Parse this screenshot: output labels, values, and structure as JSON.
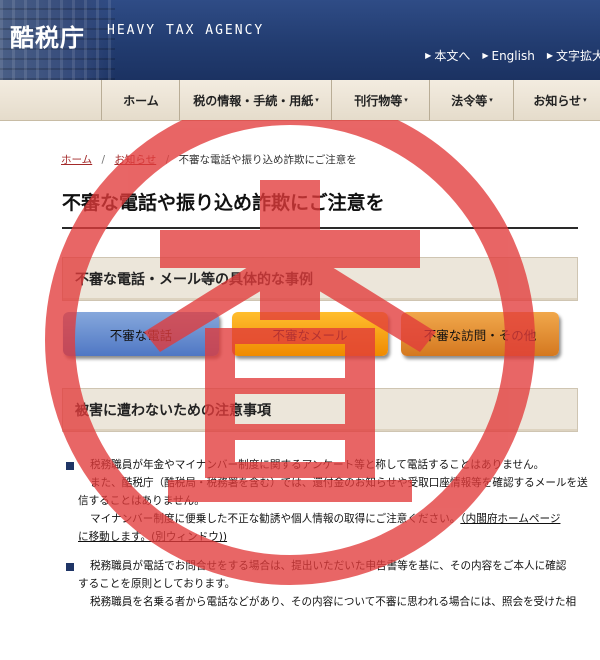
{
  "header": {
    "logo_kanji": "酷税庁",
    "logo_en": "HEAVY TAX AGENCY",
    "links": [
      {
        "label": "本文へ"
      },
      {
        "label": "English"
      },
      {
        "label": "文字拡大"
      }
    ]
  },
  "nav": {
    "items": [
      {
        "label": "ホーム",
        "has_caret": false
      },
      {
        "label": "税の情報・手続・用紙",
        "has_caret": true
      },
      {
        "label": "刊行物等",
        "has_caret": true
      },
      {
        "label": "法令等",
        "has_caret": true
      },
      {
        "label": "お知らせ",
        "has_caret": true
      }
    ],
    "caret": "▾"
  },
  "breadcrumb": {
    "items": [
      "ホーム",
      "お知らせ",
      "不審な電話や振り込め詐欺にご注意を"
    ],
    "separator": "/"
  },
  "page_title": "不審な電話や振り込め詐欺にご注意を",
  "sections": {
    "cases_heading": "不審な電話・メール等の具体的な事例",
    "precautions_heading": "被害に遭わないための注意事項"
  },
  "case_buttons": [
    {
      "label": "不審な電話",
      "color": "#4f77c4"
    },
    {
      "label": "不審なメール",
      "color": "#ef8a00"
    },
    {
      "label": "不審な訪問・その他",
      "color": "#d4781f"
    }
  ],
  "notices": {
    "p1_l1": "税務職員が年金やマイナンバー制度に関するアンケート等と称して電話することはありません。",
    "p1_l2": "また、酷税庁（酷税局・税務署を含む）では、還付金のお知らせや受取口座情報等を確認するメールを送",
    "p1_l3": "信することはありません。",
    "p1_l4a": "マイナンバー制度に便乗した不正な勧誘や個人情報の取得にご注意ください。",
    "p1_l4b": "（内閣府ホームページ",
    "p1_l5": "に移動します。(別ウィンドウ))",
    "p2_l1": "税務職員が電話でお問合せをする場合は、提出いただいた申告書等を基に、その内容をご本人に確認",
    "p2_l2": "することを原則としております。",
    "p2_l3": "税務職員を名乗る者から電話などがあり、その内容について不審に思われる場合には、照会を受けた相"
  },
  "stamp": {
    "glyph": "査",
    "color": "#e23b3b",
    "opacity": 0.78
  },
  "colors": {
    "header_bg": "#223c70",
    "nav_bg": "#ece4d4",
    "link_red": "#a32a2a",
    "bullet_navy": "#1f3566"
  }
}
